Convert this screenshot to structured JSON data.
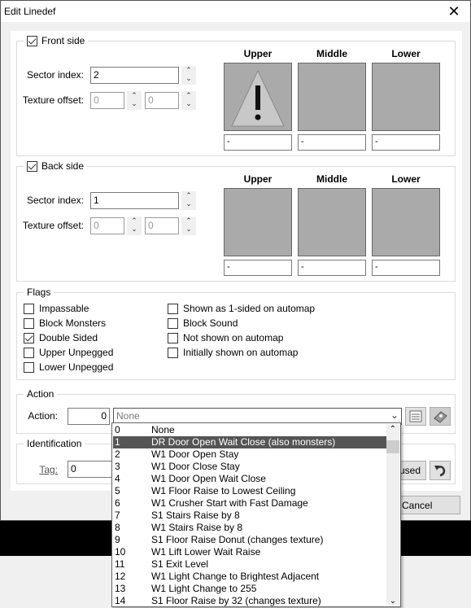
{
  "window": {
    "title": "Edit Linedef",
    "close_glyph": "✕"
  },
  "front": {
    "label": "Front side",
    "checked": true,
    "sector_label": "Sector index:",
    "sector": "2",
    "offset_label": "Texture offset:",
    "offset_x": "0",
    "offset_y": "0",
    "columns": [
      "Upper",
      "Middle",
      "Lower"
    ],
    "textures": [
      "-",
      "-",
      "-"
    ]
  },
  "back": {
    "label": "Back side",
    "checked": true,
    "sector_label": "Sector index:",
    "sector": "1",
    "offset_label": "Texture offset:",
    "offset_x": "0",
    "offset_y": "0",
    "columns": [
      "Upper",
      "Middle",
      "Lower"
    ],
    "textures": [
      "-",
      "-",
      "-"
    ]
  },
  "flags": {
    "title": "Flags",
    "items": [
      {
        "label": "Impassable",
        "checked": false
      },
      {
        "label": "Block Monsters",
        "checked": false
      },
      {
        "label": "Double Sided",
        "checked": true
      },
      {
        "label": "Upper Unpegged",
        "checked": false
      },
      {
        "label": "Lower Unpegged",
        "checked": false
      },
      {
        "label": "Shown as 1-sided on automap",
        "checked": false
      },
      {
        "label": "Block Sound",
        "checked": false
      },
      {
        "label": "Not shown on automap",
        "checked": false
      },
      {
        "label": "Initially shown on automap",
        "checked": false
      }
    ]
  },
  "action": {
    "title": "Action",
    "label": "Action:",
    "value": "0",
    "selected": "None"
  },
  "identification": {
    "title": "Identification",
    "tag_label": "Tag:",
    "tag": "0",
    "unused_label": "used"
  },
  "footer": {
    "cancel": "Cancel"
  },
  "dropdown": {
    "selected_index": 1,
    "items": [
      {
        "n": "0",
        "t": "None"
      },
      {
        "n": "1",
        "t": "DR Door Open Wait Close (also monsters)"
      },
      {
        "n": "2",
        "t": "W1 Door Open Stay"
      },
      {
        "n": "3",
        "t": "W1 Door Close Stay"
      },
      {
        "n": "4",
        "t": "W1 Door Open Wait Close"
      },
      {
        "n": "5",
        "t": "W1 Floor Raise to Lowest Ceiling"
      },
      {
        "n": "6",
        "t": "W1 Crusher Start with Fast Damage"
      },
      {
        "n": "7",
        "t": "S1 Stairs Raise by 8"
      },
      {
        "n": "8",
        "t": "W1 Stairs Raise by 8"
      },
      {
        "n": "9",
        "t": "S1 Floor Raise Donut (changes texture)"
      },
      {
        "n": "10",
        "t": "W1 Lift Lower Wait Raise"
      },
      {
        "n": "11",
        "t": "S1 Exit Level"
      },
      {
        "n": "12",
        "t": "W1 Light Change to Brightest Adjacent"
      },
      {
        "n": "13",
        "t": "W1 Light Change to 255"
      },
      {
        "n": "14",
        "t": "S1 Floor Raise by 32 (changes texture)"
      }
    ]
  }
}
